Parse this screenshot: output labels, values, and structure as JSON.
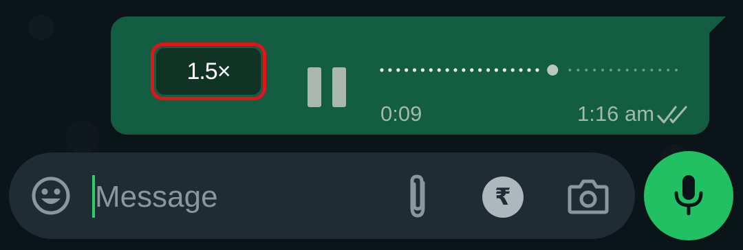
{
  "voice_message": {
    "speed_label": "1.5×",
    "elapsed_time": "0:09",
    "sent_time": "1:16 am",
    "status": "read",
    "playback_progress": 0.58,
    "state": "playing"
  },
  "composer": {
    "placeholder": "Message",
    "payment_symbol": "₹"
  },
  "icons": {
    "emoji": "smiley-icon",
    "attach": "paperclip-icon",
    "payment": "rupee-icon",
    "camera": "camera-icon",
    "mic": "microphone-icon",
    "pause": "pause-icon",
    "ticks": "double-check-icon"
  },
  "colors": {
    "bubble": "#135d42",
    "accent": "#21c063",
    "highlight": "#e3121b",
    "composer": "#1f2c33"
  }
}
